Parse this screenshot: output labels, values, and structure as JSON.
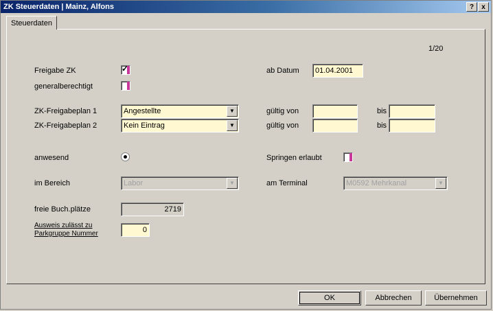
{
  "window": {
    "title": "ZK Steuerdaten | Mainz, Alfons",
    "help_label": "?",
    "close_label": "x"
  },
  "tabs": [
    {
      "label": "Steuerdaten"
    }
  ],
  "page_indicator": "1/20",
  "form": {
    "freigabe_zk_label": "Freigabe ZK",
    "generalberechtigt_label": "generalberechtigt",
    "ab_datum_label": "ab Datum",
    "ab_datum_value": "01.04.2001",
    "freigabeplan1_label": "ZK-Freigabeplan 1",
    "freigabeplan1_value": "Angestellte",
    "freigabeplan2_label": "ZK-Freigabeplan 2",
    "freigabeplan2_value": "Kein Eintrag",
    "gueltig_von_label": "gültig von",
    "bis_label": "bis",
    "anwesend_label": "anwesend",
    "springen_label": "Springen erlaubt",
    "im_bereich_label": "im Bereich",
    "im_bereich_value": "Labor",
    "am_terminal_label": "am Terminal",
    "am_terminal_value": "M0592 Mehrkanal",
    "freie_buchplaetze_label": "freie Buch.plätze",
    "freie_buchplaetze_value": "2719",
    "ausweis_label_line1": "Ausweis zulässt zu",
    "ausweis_label_line2": "Parkgruppe Nummer",
    "ausweis_value": "0"
  },
  "buttons": {
    "ok": "OK",
    "abbrechen": "Abbrechen",
    "uebernehmen": "Übernehmen"
  },
  "colors": {
    "field_bg": "#fff8d0",
    "checkbox_accent": "#c8389a",
    "titlebar_start": "#0a246a"
  }
}
